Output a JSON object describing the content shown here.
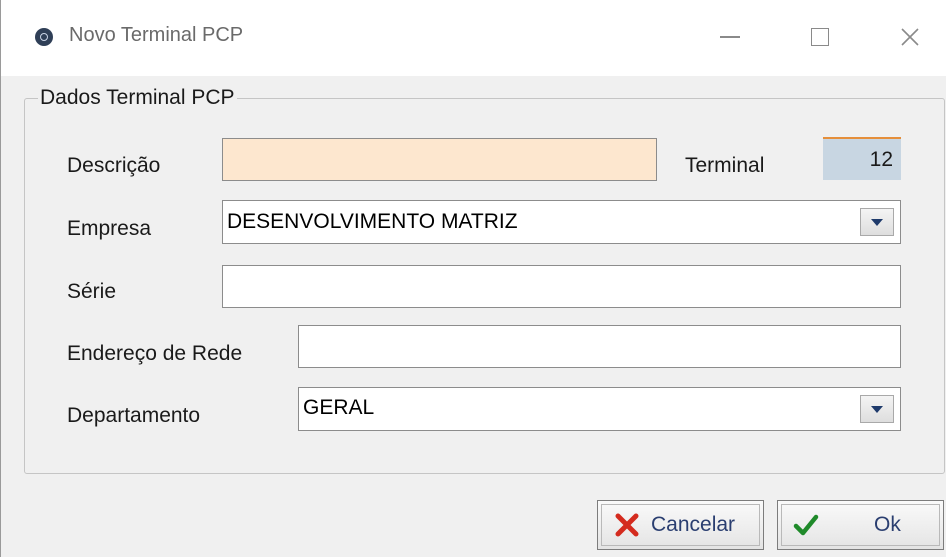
{
  "window": {
    "title": "Novo Terminal PCP",
    "icon": "app-icon"
  },
  "group": {
    "label": "Dados Terminal PCP"
  },
  "form": {
    "descricao_label": "Descrição",
    "descricao_value": "",
    "terminal_label": "Terminal",
    "terminal_value": "12",
    "empresa_label": "Empresa",
    "empresa_value": "DESENVOLVIMENTO MATRIZ",
    "serie_label": "Série",
    "serie_value": "",
    "endereco_label": "Endereço de Rede",
    "endereco_value": "",
    "departamento_label": "Departamento",
    "departamento_value": "GERAL"
  },
  "buttons": {
    "cancel_label": "Cancelar",
    "ok_label": "Ok"
  },
  "colors": {
    "required_field_bg": "#fde7cf",
    "readonly_bg": "#c8d6e2",
    "cancel_icon": "#d42b1e",
    "ok_icon": "#1f8a2a"
  }
}
